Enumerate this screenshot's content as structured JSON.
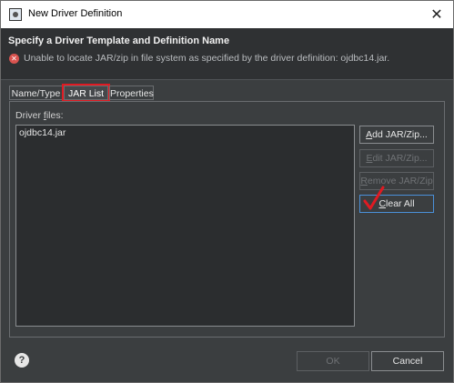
{
  "window": {
    "title": "New Driver Definition",
    "close_glyph": "✕"
  },
  "header": {
    "title": "Specify a Driver Template and Definition Name",
    "error_message": "Unable to locate JAR/zip in file system as specified by the driver definition: ojdbc14.jar."
  },
  "tabs": [
    {
      "label": "Name/Type"
    },
    {
      "label": "JAR List"
    },
    {
      "label": "Properties"
    }
  ],
  "active_tab": "JAR List",
  "jar_list": {
    "label_prefix": "Driver ",
    "label_mnemonic": "f",
    "label_suffix": "iles:",
    "files": [
      "ojdbc14.jar"
    ]
  },
  "buttons": {
    "add": {
      "mnemonic": "A",
      "rest": "dd JAR/Zip..."
    },
    "edit": {
      "mnemonic": "E",
      "rest": "dit JAR/Zip..."
    },
    "remove": {
      "mnemonic": "R",
      "rest": "emove JAR/Zip"
    },
    "clear": {
      "mnemonic": "C",
      "rest": "lear All"
    }
  },
  "footer": {
    "ok": "OK",
    "cancel": "Cancel",
    "help_glyph": "?"
  },
  "colors": {
    "highlight_red": "#e01a22",
    "background": "#3b3e40"
  }
}
